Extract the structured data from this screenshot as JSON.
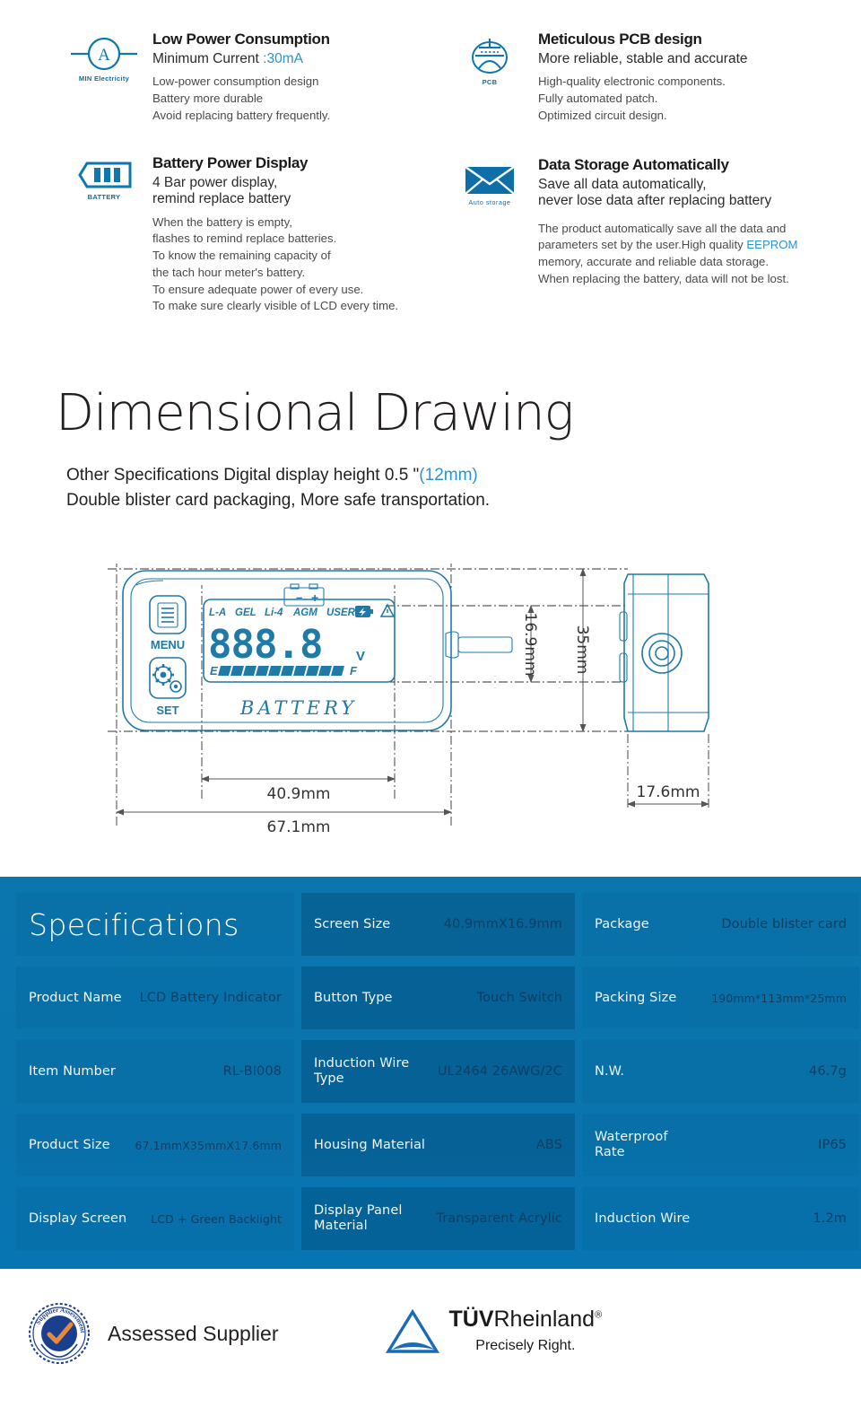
{
  "features": [
    {
      "icon": "ammeter-icon",
      "icon_caption": "MIN Electricity",
      "title": "Low Power Consumption",
      "subtitle_main": "Minimum Current ",
      "subtitle_hl": ":30mA",
      "lines": [
        "Low-power consumption design",
        "Battery more durable",
        "Avoid replacing battery frequently."
      ]
    },
    {
      "icon": "pcb-icon",
      "icon_caption": "PCB",
      "title": "Meticulous PCB design",
      "subtitle_main": "More reliable, stable and accurate",
      "subtitle_hl": "",
      "lines": [
        "High-quality electronic components.",
        "Fully automated patch.",
        "Optimized circuit design."
      ]
    },
    {
      "icon": "battery-icon",
      "icon_caption": "BATTERY",
      "title": "Battery Power Display",
      "subtitle_main": "4 Bar power display,",
      "subtitle_line2": "remind replace battery",
      "subtitle_hl": "",
      "lines": [
        "When the battery is empty,",
        "flashes to remind replace batteries.",
        "To know the remaining capacity of",
        "the tach hour meter's battery.",
        "To ensure adequate power of every use.",
        "To make sure clearly visible of LCD every time."
      ]
    },
    {
      "icon": "envelope-icon",
      "icon_caption": "Auto storage",
      "title": "Data Storage Automatically",
      "subtitle_main": "Save all data automatically,",
      "subtitle_line2": "never lose data after replacing battery",
      "subtitle_hl": "",
      "lines_rich": [
        {
          "text": "The product automatically save all the data and"
        },
        {
          "text": "parameters set by the user.High quality ",
          "hl": "EEPROM"
        },
        {
          "text": "memory, accurate and reliable data storage."
        },
        {
          "text": "When replacing the battery, data will not be lost."
        }
      ]
    }
  ],
  "dimensional": {
    "heading": "Dimensional Drawing",
    "sub_line1_a": "Other Specifications Digital display height 0.5 \"",
    "sub_line1_hl": "(12mm)",
    "sub_line2": "Double blister card packaging, More safe transportation.",
    "device": {
      "menu_label": "MENU",
      "set_label": "SET",
      "brand_label": "BATTERY",
      "lcd_modes": [
        "L-A",
        "GEL",
        "Li-4",
        "AGM",
        "USER"
      ],
      "lcd_digits": "888.8",
      "lcd_unit": "V",
      "gauge_empty": "E",
      "gauge_full": "F",
      "gauge_bars": 10,
      "battery_minus": "−",
      "battery_plus": "+"
    },
    "dims": {
      "width_outer": "67.1mm",
      "width_screen": "40.9mm",
      "height_outer": "35mm",
      "height_screen": "16.9mm",
      "depth": "17.6mm"
    }
  },
  "specifications": {
    "title": "Specifications",
    "rows": [
      {
        "left_label": "",
        "left_value": "",
        "mid_label": "Screen Size",
        "mid_value": "40.9mmX16.9mm",
        "right_label": "Package",
        "right_value": "Double blister card"
      },
      {
        "left_label": "Product Name",
        "left_value": "LCD  Battery Indicator",
        "mid_label": "Button Type",
        "mid_value": "Touch Switch",
        "right_label": "Packing Size",
        "right_value": "190mm*113mm*25mm"
      },
      {
        "left_label": "Item Number",
        "left_value": "RL-BI008",
        "mid_label": "Induction Wire\nType",
        "mid_value": "UL2464 26AWG/2C",
        "right_label": "N.W.",
        "right_value": "46.7g"
      },
      {
        "left_label": "Product Size",
        "left_value": "67.1mmX35mmX17.6mm",
        "mid_label": "Housing Material",
        "mid_value": "ABS",
        "right_label": "Waterproof\nRate",
        "right_value": "IP65"
      },
      {
        "left_label": "Display Screen",
        "left_value": "LCD + Green Backlight",
        "mid_label": "Display Panel\nMaterial",
        "mid_value": "Transparent Acrylic",
        "right_label": "Induction Wire",
        "right_value": "1.2m"
      }
    ]
  },
  "footer": {
    "assessed_badge_text": "Supplier Assessment",
    "assessed_label": "Assessed Supplier",
    "tuv_bold": "TÜV",
    "tuv_rest": "Rheinland",
    "tuv_reg": "®",
    "tuv_tagline": "Precisely Right."
  },
  "colors": {
    "accent_blue": "#2a93d5",
    "line_blue": "#1f7aa8",
    "spec_bg": "#0b76ae",
    "spec_value": "#0b3f63",
    "badge_blue": "#1b3f8f",
    "badge_orange": "#e8893a"
  }
}
